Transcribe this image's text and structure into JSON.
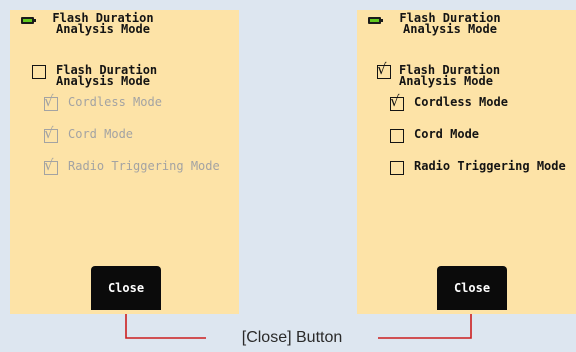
{
  "screens": [
    {
      "title": "Flash Duration\nAnalysis Mode",
      "main_option": {
        "label": "Flash Duration\nAnalysis Mode",
        "checked": false
      },
      "sub_options": [
        {
          "label": "Cordless Mode",
          "checked": true,
          "disabled": true
        },
        {
          "label": "Cord Mode",
          "checked": true,
          "disabled": true
        },
        {
          "label": "Radio Triggering Mode",
          "checked": true,
          "disabled": true
        }
      ],
      "close_label": "Close"
    },
    {
      "title": "Flash Duration\nAnalysis Mode",
      "main_option": {
        "label": "Flash Duration\nAnalysis Mode",
        "checked": true
      },
      "sub_options": [
        {
          "label": "Cordless Mode",
          "checked": true,
          "disabled": false
        },
        {
          "label": "Cord Mode",
          "checked": false,
          "disabled": false
        },
        {
          "label": "Radio Triggering Mode",
          "checked": false,
          "disabled": false
        }
      ],
      "close_label": "Close"
    }
  ],
  "callout": {
    "label": "[Close] Button",
    "color": "#cc1f1f"
  },
  "colors": {
    "screen_bg": "#fde3a7",
    "page_bg": "#dde6f0",
    "disabled": "#a3a3a3",
    "button_bg": "#0b0b0b"
  },
  "icons": {
    "battery": "battery-icon",
    "check": "checkmark-icon"
  }
}
